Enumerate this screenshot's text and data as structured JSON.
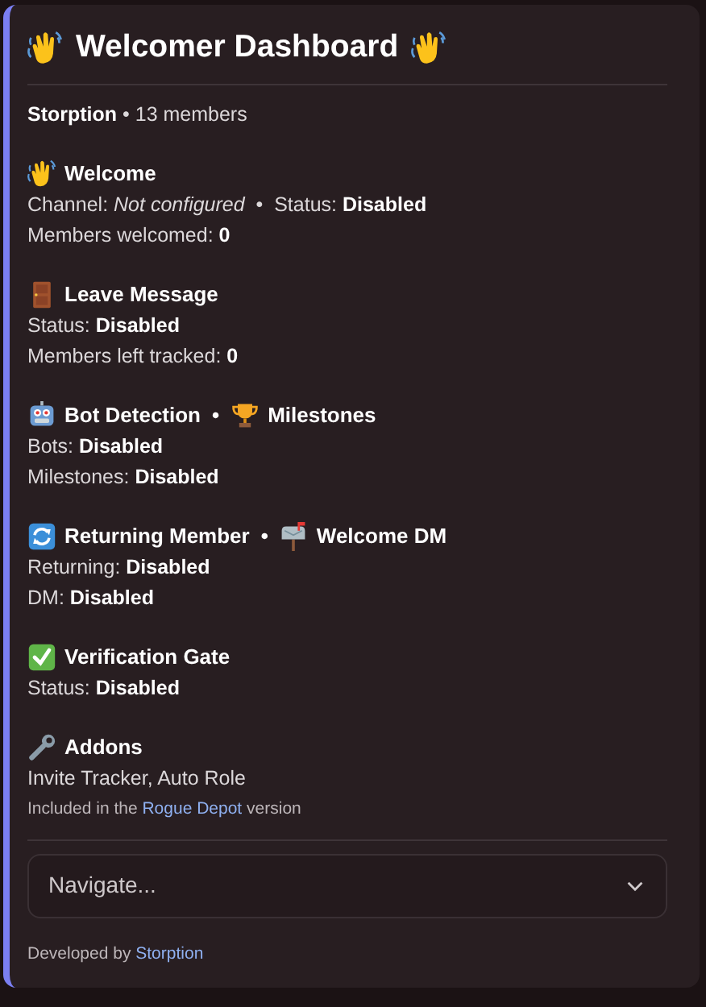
{
  "title": "Welcomer Dashboard",
  "summary": "**Storption** • 13 members",
  "sections": [
    {
      "headings": [
        "Welcome"
      ],
      "lines": [
        "Channel: *Not configured*  •  Status: **Disabled**",
        "Members welcomed: **0**"
      ]
    },
    {
      "headings": [
        "Leave Message"
      ],
      "lines": [
        "Status: **Disabled**",
        "Members left tracked: **0**"
      ]
    },
    {
      "headings": [
        "Bot Detection",
        "Milestones"
      ],
      "lines": [
        "Bots: **Disabled**",
        "Milestones: **Disabled**"
      ]
    },
    {
      "headings": [
        "Returning Member",
        "Welcome DM"
      ],
      "lines": [
        "Returning: **Disabled**",
        "DM: **Disabled**"
      ]
    },
    {
      "headings": [
        "Verification Gate"
      ],
      "lines": [
        "Status: **Disabled**"
      ]
    },
    {
      "headings": [
        "Addons"
      ],
      "lines": [
        "Invite Tracker, Auto Role"
      ],
      "note": {
        "before": "Included in the",
        "link": "Rogue Depot",
        "after": "version"
      }
    }
  ],
  "separator": "•",
  "select": {
    "placeholder": "Navigate..."
  },
  "footer": {
    "before": "Developed by",
    "link": "Storption"
  }
}
